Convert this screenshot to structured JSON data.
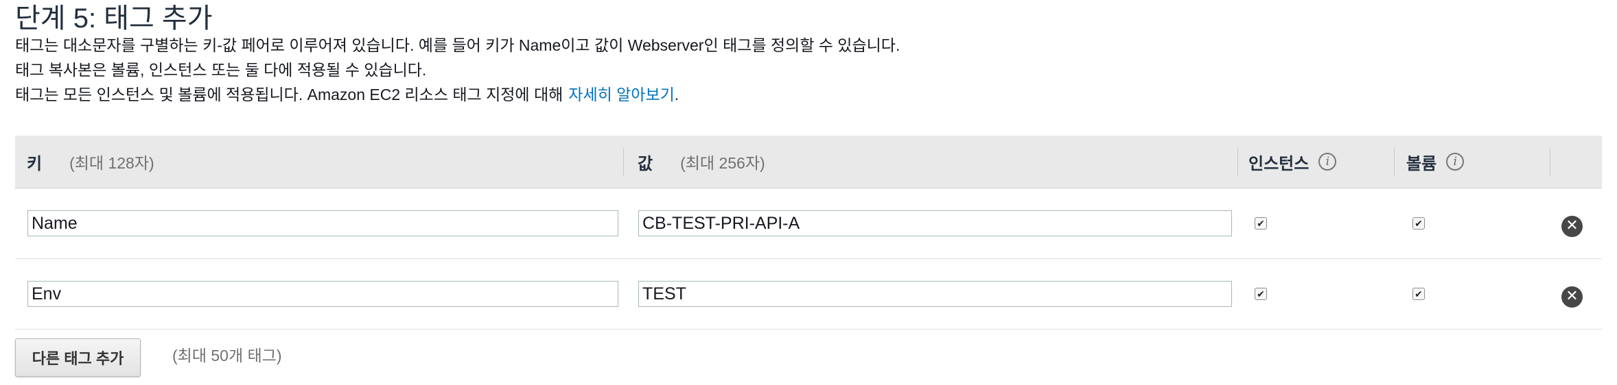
{
  "header": {
    "title": "단계 5: 태그 추가",
    "desc_line1": "태그는 대소문자를 구별하는 키-값 페어로 이루어져 있습니다. 예를 들어 키가 Name이고 값이 Webserver인 태그를 정의할 수 있습니다.",
    "desc_line2": "태그 복사본은 볼륨, 인스턴스 또는 둘 다에 적용될 수 있습니다.",
    "desc_line3": "태그는 모든 인스턴스 및 볼륨에 적용됩니다. Amazon EC2 리소스 태그 지정에 대해",
    "learn_more_link": "자세히 알아보기",
    "desc_line3_end": "."
  },
  "table": {
    "key_header": "키",
    "key_limit": "(최대 128자)",
    "value_header": "값",
    "value_limit": "(최대 256자)",
    "instances_header": "인스턴스",
    "volumes_header": "볼륨",
    "rows": [
      {
        "key": "Name",
        "value": "CB-TEST-PRI-API-A",
        "instances": true,
        "volumes": true
      },
      {
        "key": "Env",
        "value": "TEST",
        "instances": true,
        "volumes": true
      }
    ]
  },
  "footer": {
    "add_button": "다른 태그 추가",
    "limit_note": "(최대 50개 태그)"
  },
  "icons": {
    "info": "info-icon",
    "remove": "remove-circle-icon",
    "check": "checkmark-icon"
  },
  "colors": {
    "link": "#0073bb",
    "header_bg": "#e9e9e9",
    "remove_icon": "#474747"
  }
}
